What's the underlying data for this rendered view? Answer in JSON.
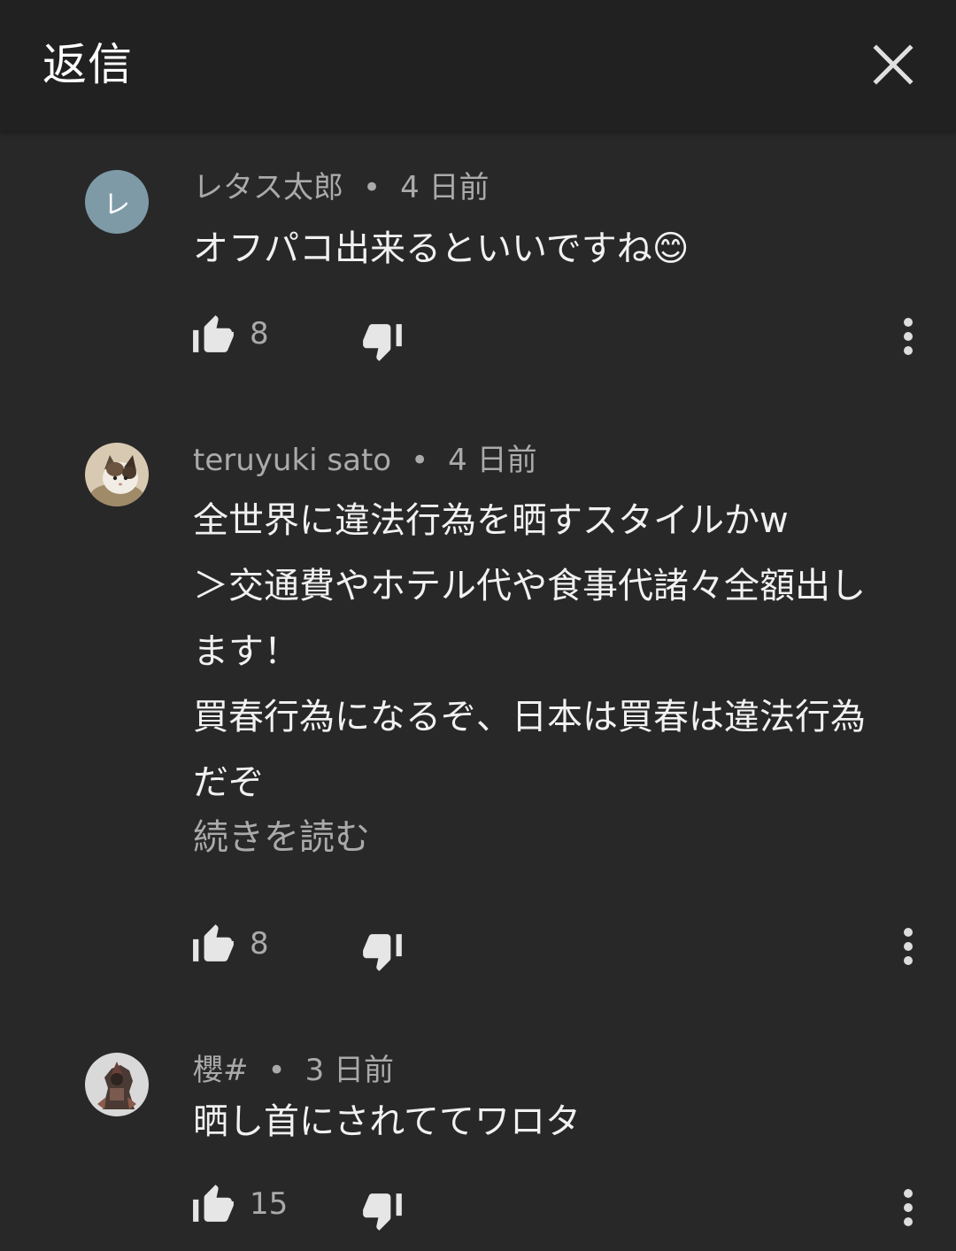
{
  "header": {
    "title": "返信"
  },
  "comments": [
    {
      "author": "レタス太郎",
      "avatar_letter": "レ",
      "time": "4 日前",
      "lines": [
        "オフパコ出来るといいですね😊"
      ],
      "likes": "8"
    },
    {
      "author": "teruyuki sato",
      "time": "4 日前",
      "lines": [
        "全世界に違法行為を晒すスタイルかw",
        "＞交通費やホテル代や食事代諸々全額出し",
        "ます！",
        "買春行為になるぞ、日本は買春は違法行為",
        "だぞ"
      ],
      "read_more": "続きを読む",
      "likes": "8"
    },
    {
      "author": "櫻#",
      "time": "3 日前",
      "lines": [
        "晒し首にされててワロタ"
      ],
      "likes": "15"
    }
  ],
  "separator": "•",
  "colors": {
    "background": "#282828",
    "header_background": "#212121",
    "primary_text": "#f1f1f1",
    "secondary_text": "#aaaaaa",
    "avatar_letter_bg": "#7e9aa7"
  },
  "icons": {
    "close": "close-icon",
    "like": "thumb-up-icon",
    "dislike": "thumb-down-icon",
    "more": "more-vert-icon"
  }
}
